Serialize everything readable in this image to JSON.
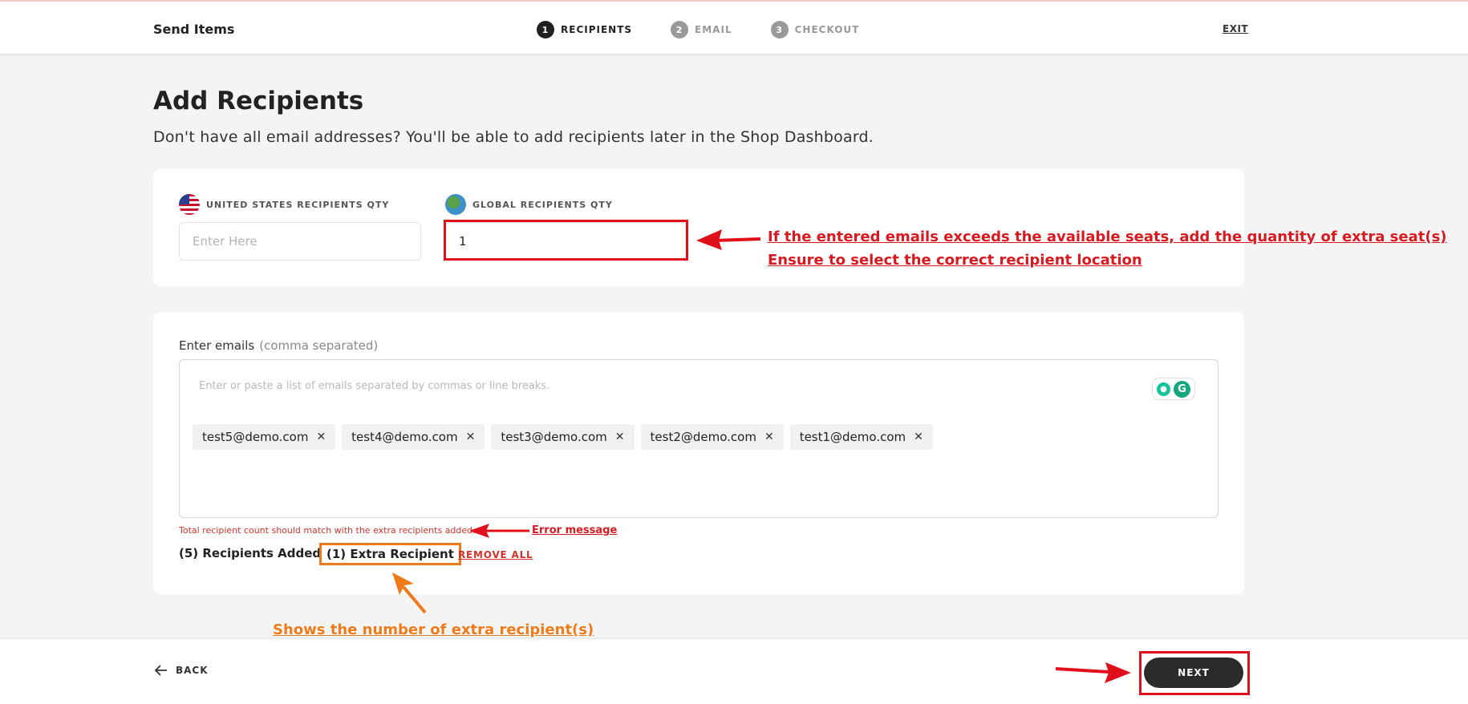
{
  "header": {
    "app_title": "Send Items",
    "steps": [
      {
        "number": "1",
        "label": "RECIPIENTS"
      },
      {
        "number": "2",
        "label": "EMAIL"
      },
      {
        "number": "3",
        "label": "CHECKOUT"
      }
    ],
    "exit_label": "EXIT"
  },
  "main": {
    "title": "Add Recipients",
    "subtitle": "Don't have all email addresses? You'll be able to add recipients later in the Shop Dashboard."
  },
  "quantities": {
    "us_label": "UNITED STATES RECIPIENTS QTY",
    "us_placeholder": "Enter Here",
    "us_value": "",
    "global_label": "GLOBAL RECIPIENTS QTY",
    "global_value": "1"
  },
  "emails": {
    "label": "Enter emails",
    "hint": "(comma separated)",
    "placeholder": "Enter or paste a list of emails separated by commas or line breaks.",
    "chips": [
      "test5@demo.com",
      "test4@demo.com",
      "test3@demo.com",
      "test2@demo.com",
      "test1@demo.com"
    ],
    "chip_remove_glyph": "✕",
    "error": "Total recipient count should match with the extra recipients added.",
    "recipients_added": "(5) Recipients Added",
    "extra_recipient": "(1) Extra Recipient",
    "remove_all": "REMOVE ALL"
  },
  "footer": {
    "back_label": "BACK",
    "next_label": "NEXT"
  },
  "annotations": {
    "qty_note_line1": "If the entered emails exceeds the available seats, add the quantity of extra seat(s)",
    "qty_note_line2": "Ensure to select the correct recipient location",
    "error_note": "Error message",
    "extra_note": "Shows the number of extra recipient(s)"
  },
  "colors": {
    "annotation_red": "#e0101a",
    "annotation_orange": "#f07a1a",
    "error_red": "#d0342c",
    "next_button": "#2b2b2b"
  }
}
